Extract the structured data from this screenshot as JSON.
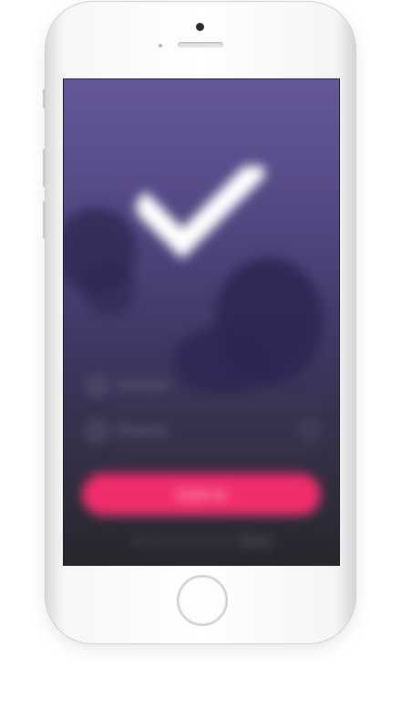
{
  "screen": {
    "check_icon": "checkmark-icon",
    "username_placeholder": "Username",
    "password_placeholder": "Password",
    "signin_label": "SIGN IN",
    "footer_text": "Don't have an account?",
    "footer_link": "Signup"
  },
  "colors": {
    "accent": "#f12d6c",
    "bg_top": "#65589a",
    "bg_bottom": "#26262c"
  }
}
